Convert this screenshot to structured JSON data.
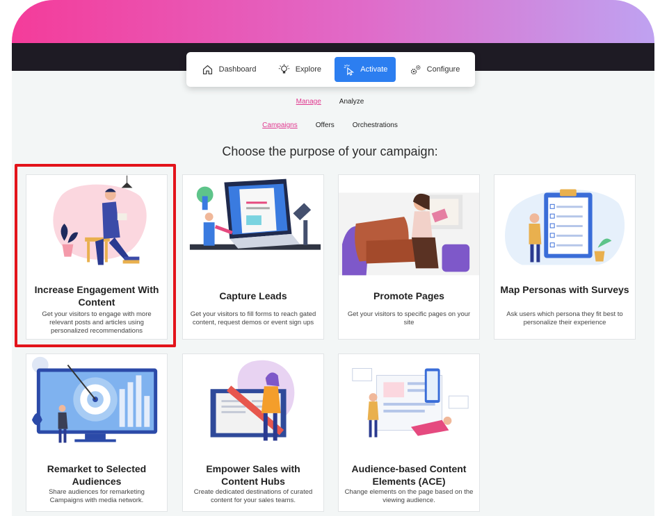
{
  "nav": {
    "items": [
      {
        "label": "Dashboard",
        "icon": "home-icon"
      },
      {
        "label": "Explore",
        "icon": "lightbulb-icon"
      },
      {
        "label": "Activate",
        "icon": "click-icon"
      },
      {
        "label": "Configure",
        "icon": "gears-icon"
      }
    ],
    "active": "Activate"
  },
  "subnav": {
    "manage": "Manage",
    "analyze": "Analyze"
  },
  "tabs": {
    "campaigns": "Campaigns",
    "offers": "Offers",
    "orchestrations": "Orchestrations"
  },
  "heading": "Choose the purpose of your campaign:",
  "cards": [
    {
      "title": "Increase Engagement With Content",
      "desc": "Get your visitors to engage with more relevant posts and articles using personalized recommendations"
    },
    {
      "title": "Capture Leads",
      "desc": "Get your visitors to fill forms to reach gated content, request demos or event sign ups"
    },
    {
      "title": "Promote Pages",
      "desc": "Get your visitors to specific pages on your site"
    },
    {
      "title": "Map Personas with Surveys",
      "desc": "Ask users which persona they fit best to personalize their experience"
    },
    {
      "title": "Remarket to Selected Audiences",
      "desc": "Share audiences for remarketing Campaigns with media network."
    },
    {
      "title": "Empower Sales with Content Hubs",
      "desc": "Create dedicated destinations of curated content for your sales teams."
    },
    {
      "title": "Audience-based Content Elements (ACE)",
      "desc": "Change elements on the page based on the viewing audience."
    }
  ],
  "colors": {
    "accent": "#2c7ef0",
    "highlight": "#e3141b",
    "link": "#e0388f"
  }
}
